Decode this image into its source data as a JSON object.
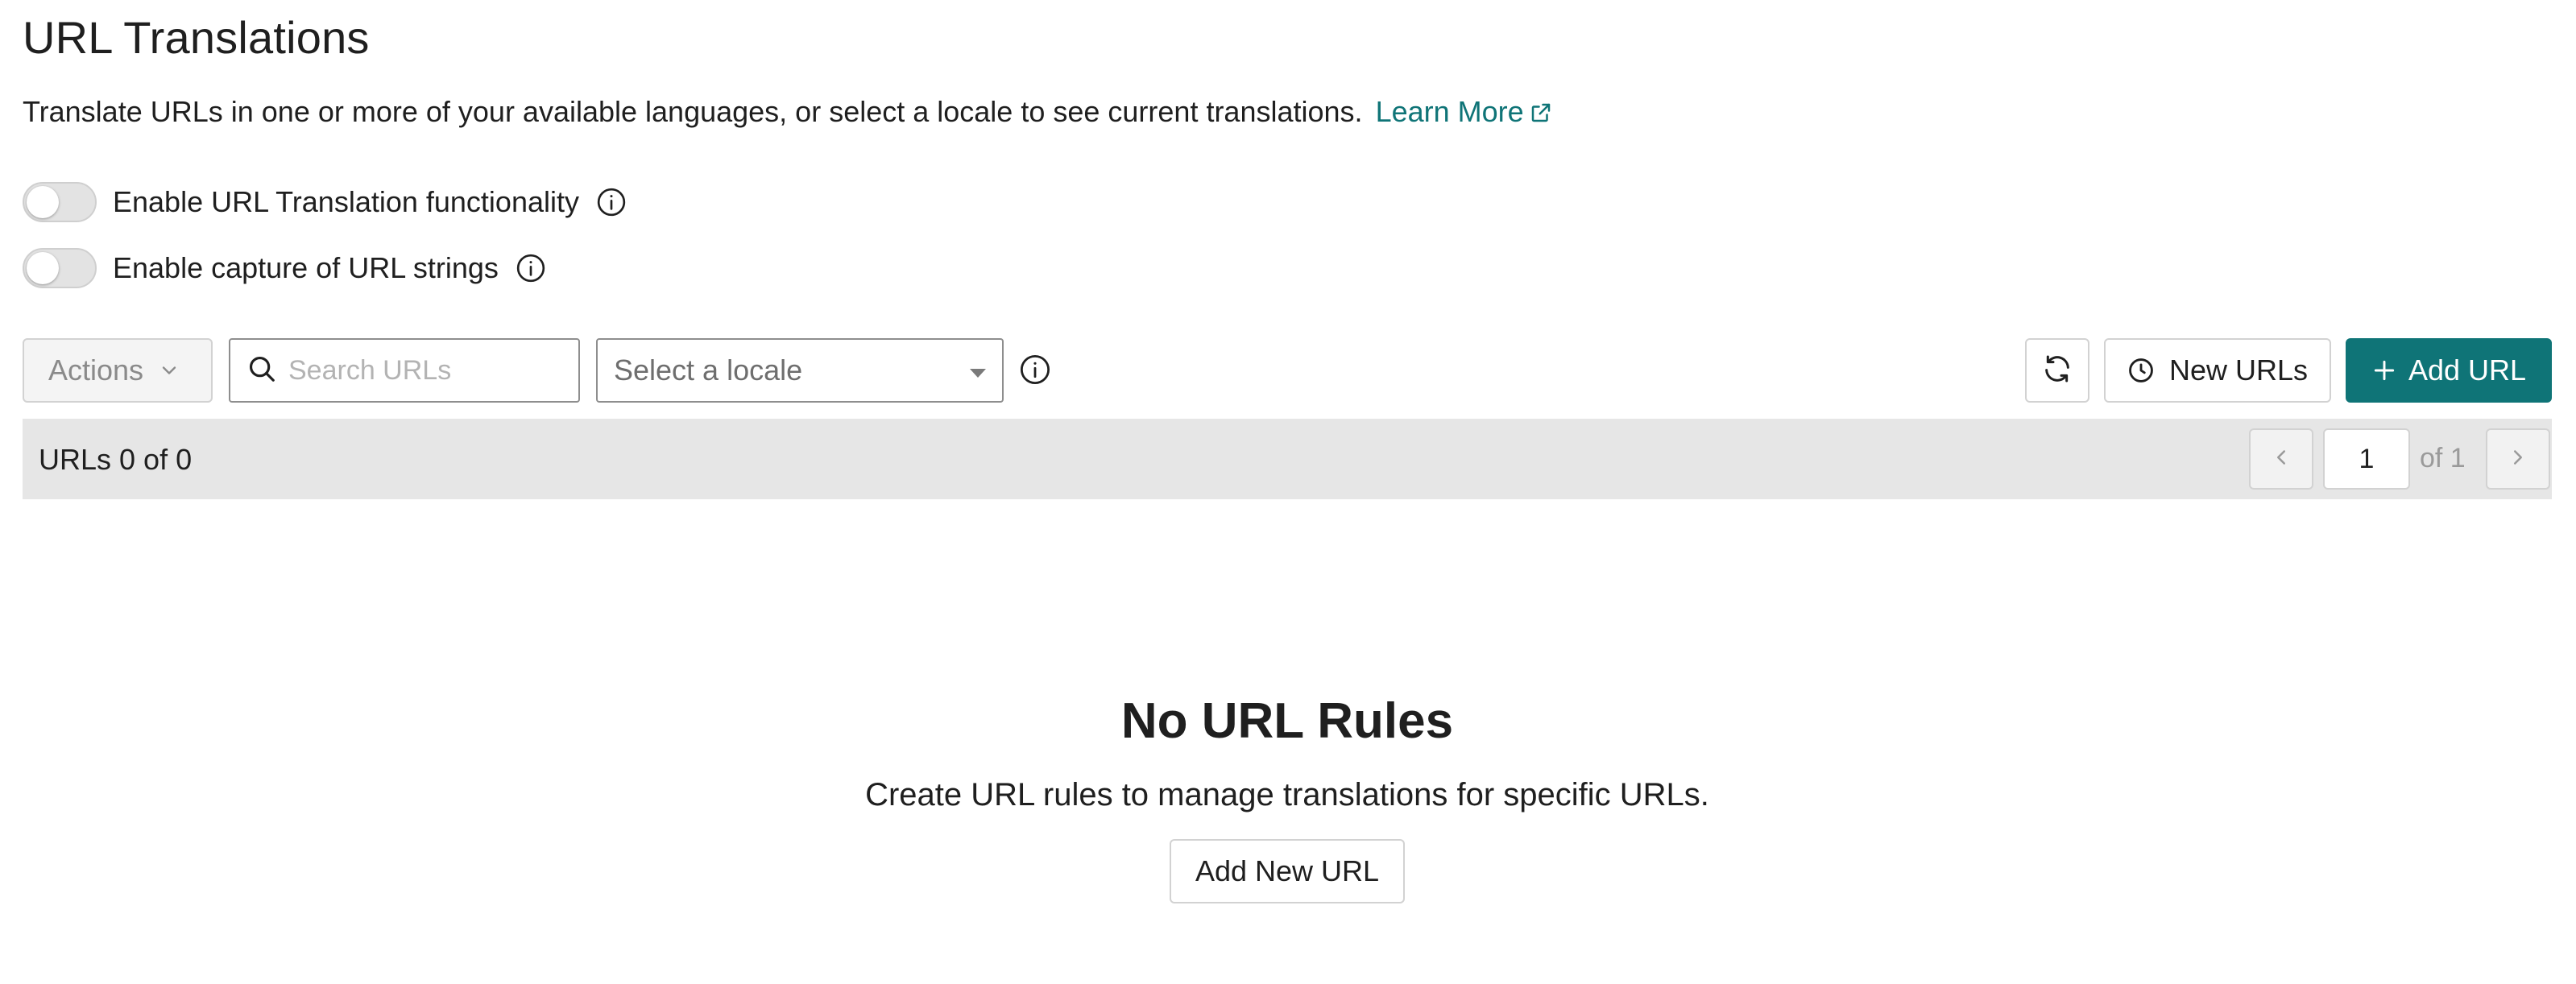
{
  "header": {
    "title": "URL Translations",
    "description": "Translate URLs in one or more of your available languages, or select a locale to see current translations.",
    "learn_more_label": "Learn More"
  },
  "toggles": [
    {
      "label": "Enable URL Translation functionality",
      "enabled": false
    },
    {
      "label": "Enable capture of URL strings",
      "enabled": false
    }
  ],
  "toolbar": {
    "actions_label": "Actions",
    "search_placeholder": "Search URLs",
    "search_value": "",
    "locale_placeholder": "Select a locale",
    "new_urls_label": "New URLs",
    "add_url_label": "Add URL"
  },
  "list_header": {
    "count_text": "URLs 0 of 0",
    "page_number": "1",
    "page_of": "of 1"
  },
  "empty_state": {
    "title": "No URL Rules",
    "description": "Create URL rules to manage translations for specific URLs.",
    "button_label": "Add New URL"
  },
  "colors": {
    "accent": "#0f7477",
    "toolbar_band": "#e6e6e6",
    "toggle_off": "#e3e3e3"
  },
  "icons": {
    "external_link": "external-link-icon",
    "info": "info-icon",
    "search": "search-icon",
    "chevron_down": "chevron-down-icon",
    "refresh": "refresh-icon",
    "clock": "clock-icon",
    "plus": "plus-icon",
    "chevron_left": "chevron-left-icon",
    "chevron_right": "chevron-right-icon"
  }
}
